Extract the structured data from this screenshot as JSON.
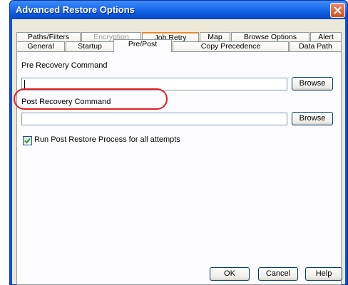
{
  "window": {
    "title": "Advanced Restore Options"
  },
  "tabs": {
    "row1": [
      {
        "label": "Paths/Filters",
        "state": "normal"
      },
      {
        "label": "Encryption",
        "state": "disabled"
      },
      {
        "label": "Job Retry",
        "state": "hot"
      },
      {
        "label": "Map",
        "state": "normal"
      },
      {
        "label": "Browse Options",
        "state": "normal"
      },
      {
        "label": "Alert",
        "state": "normal"
      }
    ],
    "row2": [
      {
        "label": "General",
        "state": "normal"
      },
      {
        "label": "Startup",
        "state": "normal"
      },
      {
        "label": "Pre/Post",
        "state": "selected"
      },
      {
        "label": "Copy Precedence",
        "state": "normal"
      },
      {
        "label": "Data Path",
        "state": "normal"
      }
    ]
  },
  "pre_post": {
    "pre_recovery_label": "Pre Recovery Command",
    "pre_recovery_value": "",
    "post_recovery_label": "Post Recovery Command",
    "post_recovery_value": "",
    "browse_label": "Browse",
    "run_post_restore_label": "Run Post Restore Process for all attempts",
    "run_post_restore_checked": true
  },
  "footer": {
    "ok_label": "OK",
    "cancel_label": "Cancel",
    "help_label": "Help"
  },
  "colors": {
    "titlebar": "#0a5ae0",
    "highlight_ring": "#e02020",
    "hot_tab_accent": "#e68b2c",
    "dialog_face": "#ece9d8"
  }
}
